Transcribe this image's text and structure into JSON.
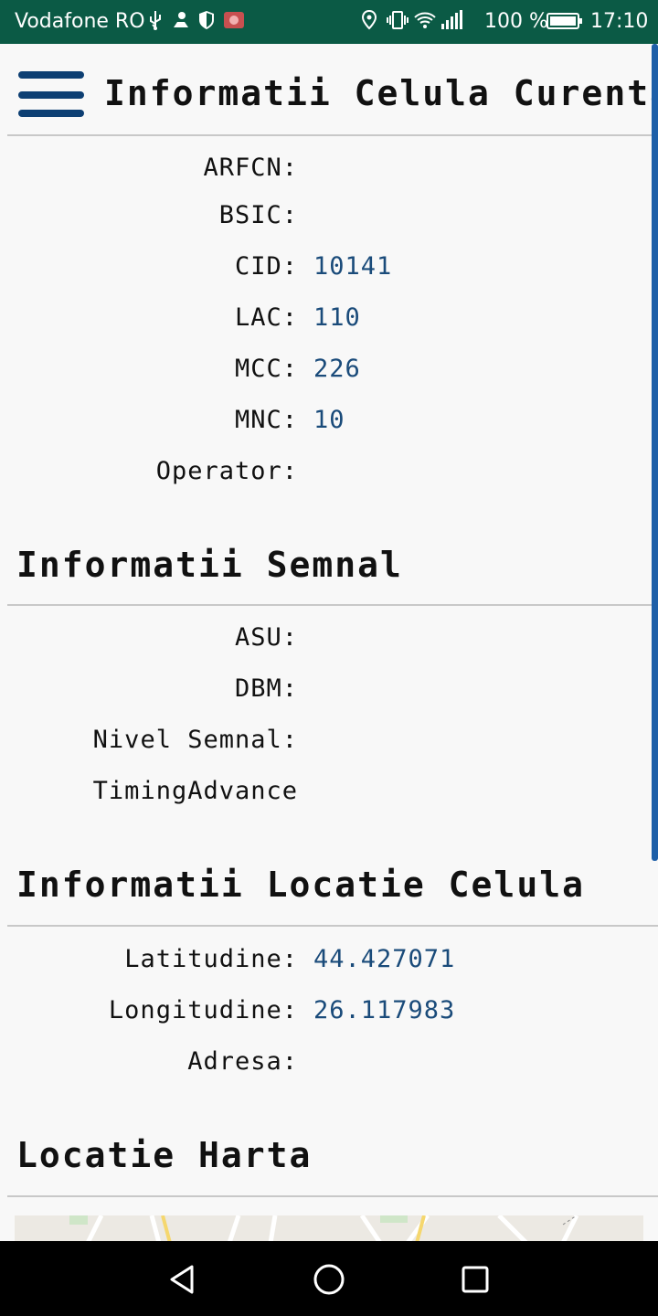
{
  "status_bar": {
    "carrier": "Vodafone RO",
    "battery_percent": "100 %",
    "time": "17:10",
    "icons_left": [
      "usb-icon",
      "location-person-icon",
      "shield-icon",
      "huawei-app-icon"
    ],
    "icons_right": [
      "location-pin-icon",
      "vibrate-icon",
      "wifi-icon",
      "signal-icon"
    ]
  },
  "app_bar": {
    "title": "Informatii Celula Curenta",
    "menu_icon": "hamburger-menu-icon"
  },
  "cell_info": {
    "rows": [
      {
        "label": "ARFCN:",
        "value": ""
      },
      {
        "label": "BSIC:",
        "value": ""
      },
      {
        "label": "CID:",
        "value": "10141"
      },
      {
        "label": "LAC:",
        "value": "110"
      },
      {
        "label": "MCC:",
        "value": "226"
      },
      {
        "label": "MNC:",
        "value": "10"
      },
      {
        "label": "Operator:",
        "value": ""
      }
    ]
  },
  "signal_info": {
    "title": "Informatii Semnal",
    "rows": [
      {
        "label": "ASU:",
        "value": ""
      },
      {
        "label": "DBM:",
        "value": ""
      },
      {
        "label": "Nivel Semnal:",
        "value": ""
      },
      {
        "label": "TimingAdvance",
        "value": ""
      }
    ]
  },
  "location_info": {
    "title": "Informatii Locatie Celula",
    "rows": [
      {
        "label": "Latitudine:",
        "value": "44.427071"
      },
      {
        "label": "Longitudine:",
        "value": "26.117983"
      },
      {
        "label": "Adresa:",
        "value": ""
      }
    ]
  },
  "map_section": {
    "title": "Locatie Harta"
  },
  "nav_bar": {
    "icons": [
      "back-icon",
      "home-icon",
      "recents-icon"
    ]
  },
  "colors": {
    "status_bar_bg": "#0b5a45",
    "accent": "#0d3f73",
    "value_text": "#1a4b7a"
  }
}
